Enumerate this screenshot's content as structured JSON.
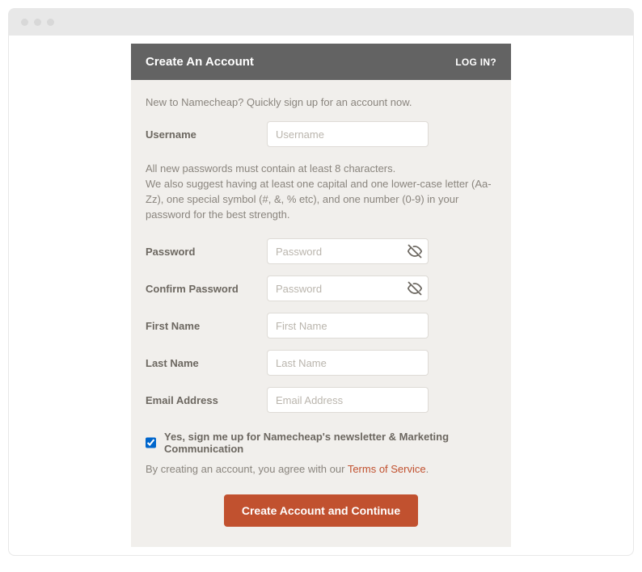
{
  "header": {
    "title": "Create An Account",
    "login_link": "LOG IN?"
  },
  "intro": "New to Namecheap? Quickly sign up for an account now.",
  "password_hint_line1": "All new passwords must contain at least 8 characters.",
  "password_hint_line2": "We also suggest having at least one capital and one lower-case letter (Aa-Zz), one special symbol (#, &, % etc), and one number (0-9) in your password for the best strength.",
  "fields": {
    "username": {
      "label": "Username",
      "placeholder": "Username",
      "value": ""
    },
    "password": {
      "label": "Password",
      "placeholder": "Password",
      "value": ""
    },
    "confirm_password": {
      "label": "Confirm Password",
      "placeholder": "Password",
      "value": ""
    },
    "first_name": {
      "label": "First Name",
      "placeholder": "First Name",
      "value": ""
    },
    "last_name": {
      "label": "Last Name",
      "placeholder": "Last Name",
      "value": ""
    },
    "email": {
      "label": "Email Address",
      "placeholder": "Email Address",
      "value": ""
    }
  },
  "newsletter": {
    "checked": true,
    "label": "Yes, sign me up for Namecheap's newsletter & Marketing Communication"
  },
  "terms": {
    "prefix": "By creating an account, you agree with our ",
    "link_text": "Terms of Service",
    "suffix": "."
  },
  "submit_label": "Create Account and Continue"
}
